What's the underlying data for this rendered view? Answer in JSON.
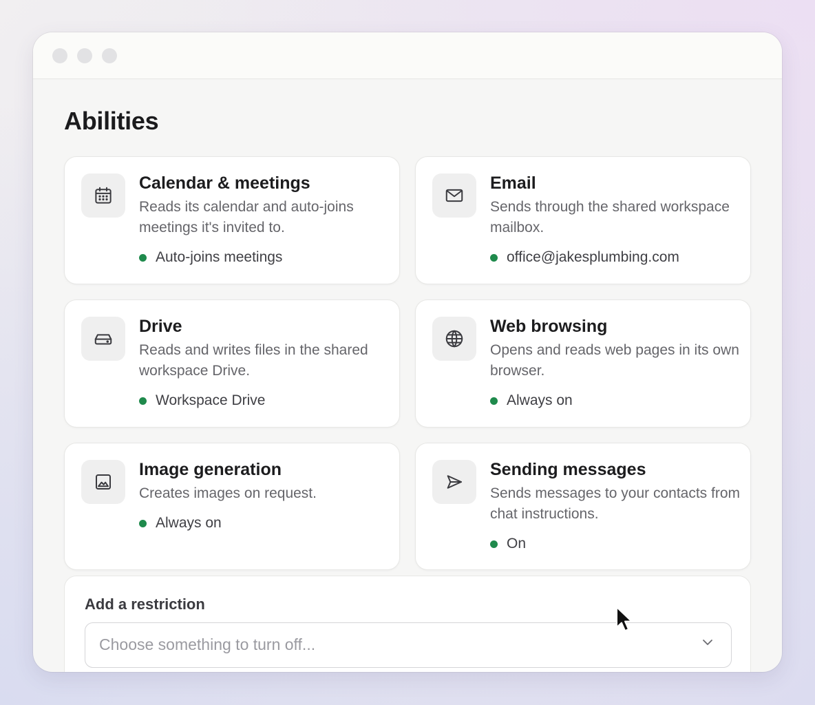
{
  "page": {
    "title": "Abilities"
  },
  "abilities": [
    {
      "title": "Calendar & meetings",
      "description": "Reads its calendar and auto-joins meetings it's invited to.",
      "status": "Auto-joins meetings",
      "icon": "calendar-icon"
    },
    {
      "title": "Email",
      "description": "Sends through the shared workspace mailbox.",
      "status": "office@jakesplumbing.com",
      "icon": "mail-icon"
    },
    {
      "title": "Drive",
      "description": "Reads and writes files in the shared workspace Drive.",
      "status": "Workspace Drive",
      "icon": "drive-icon"
    },
    {
      "title": "Web browsing",
      "description": "Opens and reads web pages in its own browser.",
      "status": "Always on",
      "icon": "globe-icon"
    },
    {
      "title": "Image generation",
      "description": "Creates images on request.",
      "status": "Always on",
      "icon": "image-icon"
    },
    {
      "title": "Sending messages",
      "description": "Sends messages to your contacts from chat instructions.",
      "status": "On",
      "icon": "send-icon"
    }
  ],
  "restriction": {
    "label": "Add a restriction",
    "placeholder": "Choose something to turn off..."
  },
  "colors": {
    "status_on": "#1f8a4c",
    "window_bg": "#f6f6f5"
  }
}
